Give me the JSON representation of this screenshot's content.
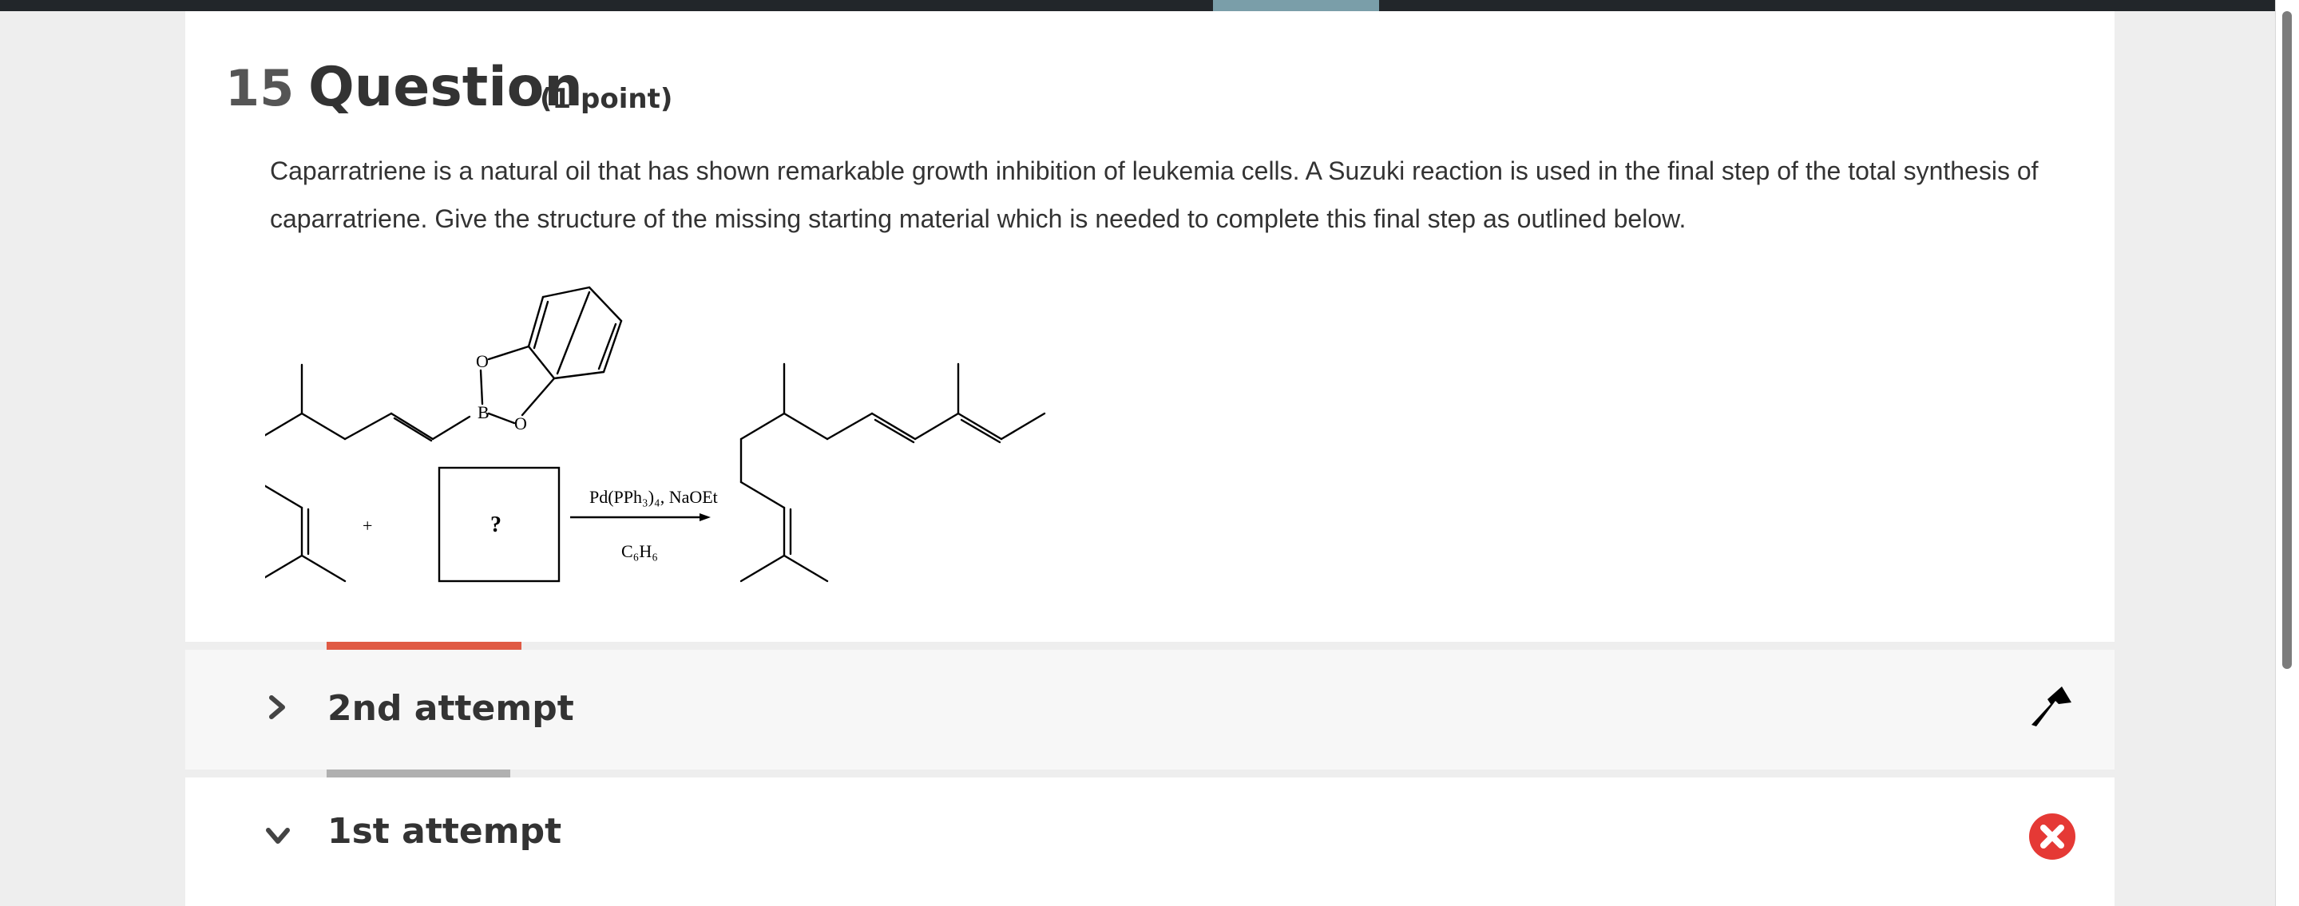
{
  "question": {
    "number": "15",
    "title": "Question",
    "points": "(1 point)",
    "body": "Caparratriene is a natural oil that has shown remarkable growth inhibition of leukemia cells. A Suzuki reaction is used in the final step of the total synthesis of caparratriene. Give the structure of the missing starting material which is needed to complete this final step as outlined below."
  },
  "reaction": {
    "plus": "+",
    "unknown": "?",
    "reagents": "Pd(PPh₃)₄, NaOEt",
    "solvent": "C₆H₆",
    "atom_labels": [
      "O",
      "B",
      "O"
    ]
  },
  "attempts": [
    {
      "label": "2nd attempt",
      "expanded": false,
      "status_icon": "flag-icon"
    },
    {
      "label": "1st attempt",
      "expanded": true,
      "status_icon": "incorrect-x-icon"
    }
  ],
  "colors": {
    "active_tab": "#e05a44",
    "inactive_tab": "#b0b0b0",
    "error": "#e53935",
    "top_bar": "#22262a",
    "top_bar_progress": "#7a9ea9"
  }
}
